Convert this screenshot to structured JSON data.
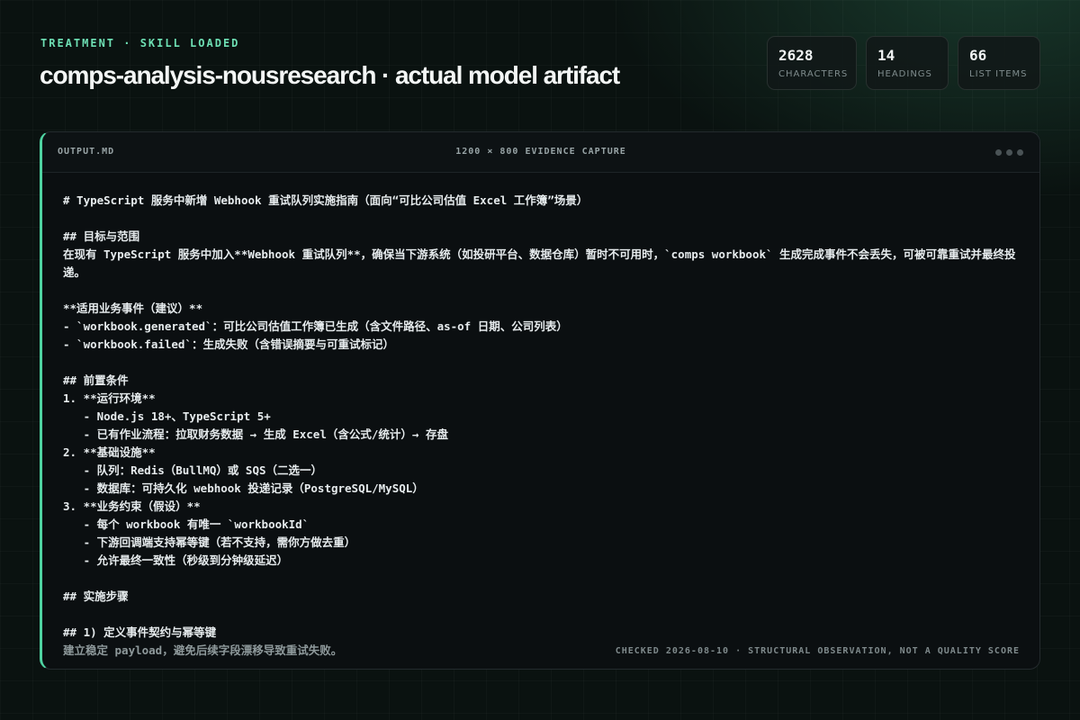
{
  "header": {
    "eyebrow": "TREATMENT · SKILL LOADED",
    "title": "comps-analysis-nousresearch · actual model artifact"
  },
  "stats": [
    {
      "value": "2628",
      "label": "CHARACTERS"
    },
    {
      "value": "14",
      "label": "HEADINGS"
    },
    {
      "value": "66",
      "label": "LIST ITEMS"
    }
  ],
  "panel": {
    "filename": "OUTPUT.MD",
    "caption": "1200 × 800 EVIDENCE CAPTURE",
    "footer": "CHECKED 2026-08-10 · STRUCTURAL OBSERVATION, NOT A QUALITY SCORE",
    "lines": [
      "# TypeScript 服务中新增 Webhook 重试队列实施指南（面向“可比公司估值 Excel 工作簿”场景）",
      "",
      "## 目标与范围",
      "在现有 TypeScript 服务中加入**Webhook 重试队列**，确保当下游系统（如投研平台、数据仓库）暂时不可用时，`comps workbook` 生成完成事件不会丢失，可被可靠重试并最终投递。",
      "",
      "**适用业务事件（建议）**",
      "- `workbook.generated`：可比公司估值工作簿已生成（含文件路径、as-of 日期、公司列表）",
      "- `workbook.failed`：生成失败（含错误摘要与可重试标记）",
      "",
      "## 前置条件",
      "1. **运行环境**",
      "   - Node.js 18+、TypeScript 5+",
      "   - 已有作业流程：拉取财务数据 → 生成 Excel（含公式/统计）→ 存盘",
      "2. **基础设施**",
      "   - 队列：Redis（BullMQ）或 SQS（二选一）",
      "   - 数据库：可持久化 webhook 投递记录（PostgreSQL/MySQL）",
      "3. **业务约束（假设）**",
      "   - 每个 workbook 有唯一 `workbookId`",
      "   - 下游回调端支持幂等键（若不支持，需你方做去重）",
      "   - 允许最终一致性（秒级到分钟级延迟）",
      "",
      "## 实施步骤",
      "",
      "## 1) 定义事件契约与幂等键",
      "建立稳定 payload，避免后续字段漂移导致重试失败。"
    ]
  }
}
